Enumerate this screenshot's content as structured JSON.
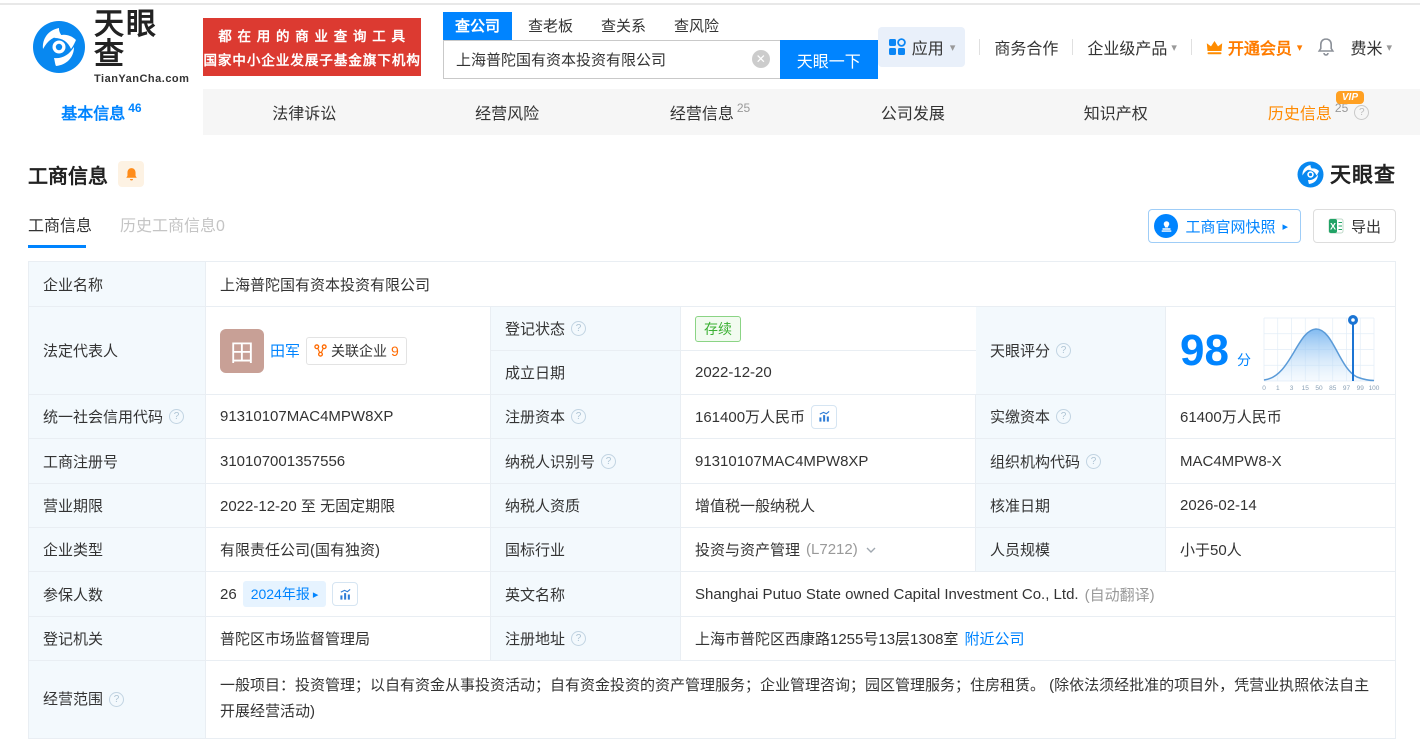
{
  "header": {
    "logo": {
      "title": "天眼查",
      "subtitle": "TianYanCha.com"
    },
    "banner": {
      "line1": "都 在 用 的 商 业 查 询 工 具",
      "line2": "国家中小企业发展子基金旗下机构"
    },
    "search": {
      "tabs": [
        {
          "label": "查公司"
        },
        {
          "label": "查老板"
        },
        {
          "label": "查关系"
        },
        {
          "label": "查风险"
        }
      ],
      "value": "上海普陀国有资本投资有限公司",
      "button": "天眼一下"
    },
    "nav": {
      "apps": "应用",
      "cooperation": "商务合作",
      "enterprise": "企业级产品",
      "vip": "开通会员",
      "user": "费米"
    }
  },
  "tabs": [
    {
      "label": "基本信息",
      "count": "46"
    },
    {
      "label": "法律诉讼",
      "count": ""
    },
    {
      "label": "经营风险",
      "count": ""
    },
    {
      "label": "经营信息",
      "count": "25"
    },
    {
      "label": "公司发展",
      "count": ""
    },
    {
      "label": "知识产权",
      "count": ""
    },
    {
      "label": "历史信息",
      "count": "25",
      "badge": "VIP"
    }
  ],
  "section": {
    "title": "工商信息",
    "subtabs": [
      {
        "label": "工商信息"
      },
      {
        "label": "历史工商信息0"
      }
    ],
    "snapshot_button": "工商官网快照",
    "export_button": "导出",
    "watermark": "天眼查"
  },
  "fields": {
    "company_name": {
      "label": "企业名称",
      "value": "上海普陀国有资本投资有限公司"
    },
    "legal_rep": {
      "label": "法定代表人",
      "value": "田军",
      "avatar_char": "田",
      "related_label": "关联企业",
      "related_count": "9"
    },
    "reg_status": {
      "label": "登记状态",
      "value": "存续"
    },
    "establish_date": {
      "label": "成立日期",
      "value": "2022-12-20"
    },
    "score": {
      "label": "天眼评分",
      "value": "98",
      "unit": "分",
      "axis": [
        "0",
        "1",
        "3",
        "15",
        "50",
        "85",
        "97",
        "99",
        "100"
      ]
    },
    "credit_code": {
      "label": "统一社会信用代码",
      "value": "91310107MAC4MPW8XP"
    },
    "reg_capital": {
      "label": "注册资本",
      "value": "161400万人民币"
    },
    "paid_capital": {
      "label": "实缴资本",
      "value": "61400万人民币"
    },
    "reg_number": {
      "label": "工商注册号",
      "value": "310107001357556"
    },
    "taxpayer_id": {
      "label": "纳税人识别号",
      "value": "91310107MAC4MPW8XP"
    },
    "org_code": {
      "label": "组织机构代码",
      "value": "MAC4MPW8-X"
    },
    "business_term": {
      "label": "营业期限",
      "value": "2022-12-20 至 无固定期限"
    },
    "taxpayer_quality": {
      "label": "纳税人资质",
      "value": "增值税一般纳税人"
    },
    "approval_date": {
      "label": "核准日期",
      "value": "2026-02-14"
    },
    "company_type": {
      "label": "企业类型",
      "value": "有限责任公司(国有独资)"
    },
    "industry": {
      "label": "国标行业",
      "value": "投资与资产管理",
      "code": "(L7212)"
    },
    "staff_size": {
      "label": "人员规模",
      "value": "小于50人"
    },
    "insured_count": {
      "label": "参保人数",
      "value": "26",
      "report_badge": "2024年报"
    },
    "english_name": {
      "label": "英文名称",
      "value": "Shanghai Putuo State owned Capital Investment Co., Ltd.",
      "note": "(自动翻译)"
    },
    "reg_authority": {
      "label": "登记机关",
      "value": "普陀区市场监督管理局"
    },
    "reg_address": {
      "label": "注册地址",
      "value": "上海市普陀区西康路1255号13层1308室",
      "nearby_link": "附近公司"
    },
    "business_scope": {
      "label": "经营范围",
      "value": "一般项目：投资管理；以自有资金从事投资活动；自有资金投资的资产管理服务；企业管理咨询；园区管理服务；住房租赁。 (除依法须经批准的项目外，凭营业执照依法自主开展经营活动)"
    }
  }
}
